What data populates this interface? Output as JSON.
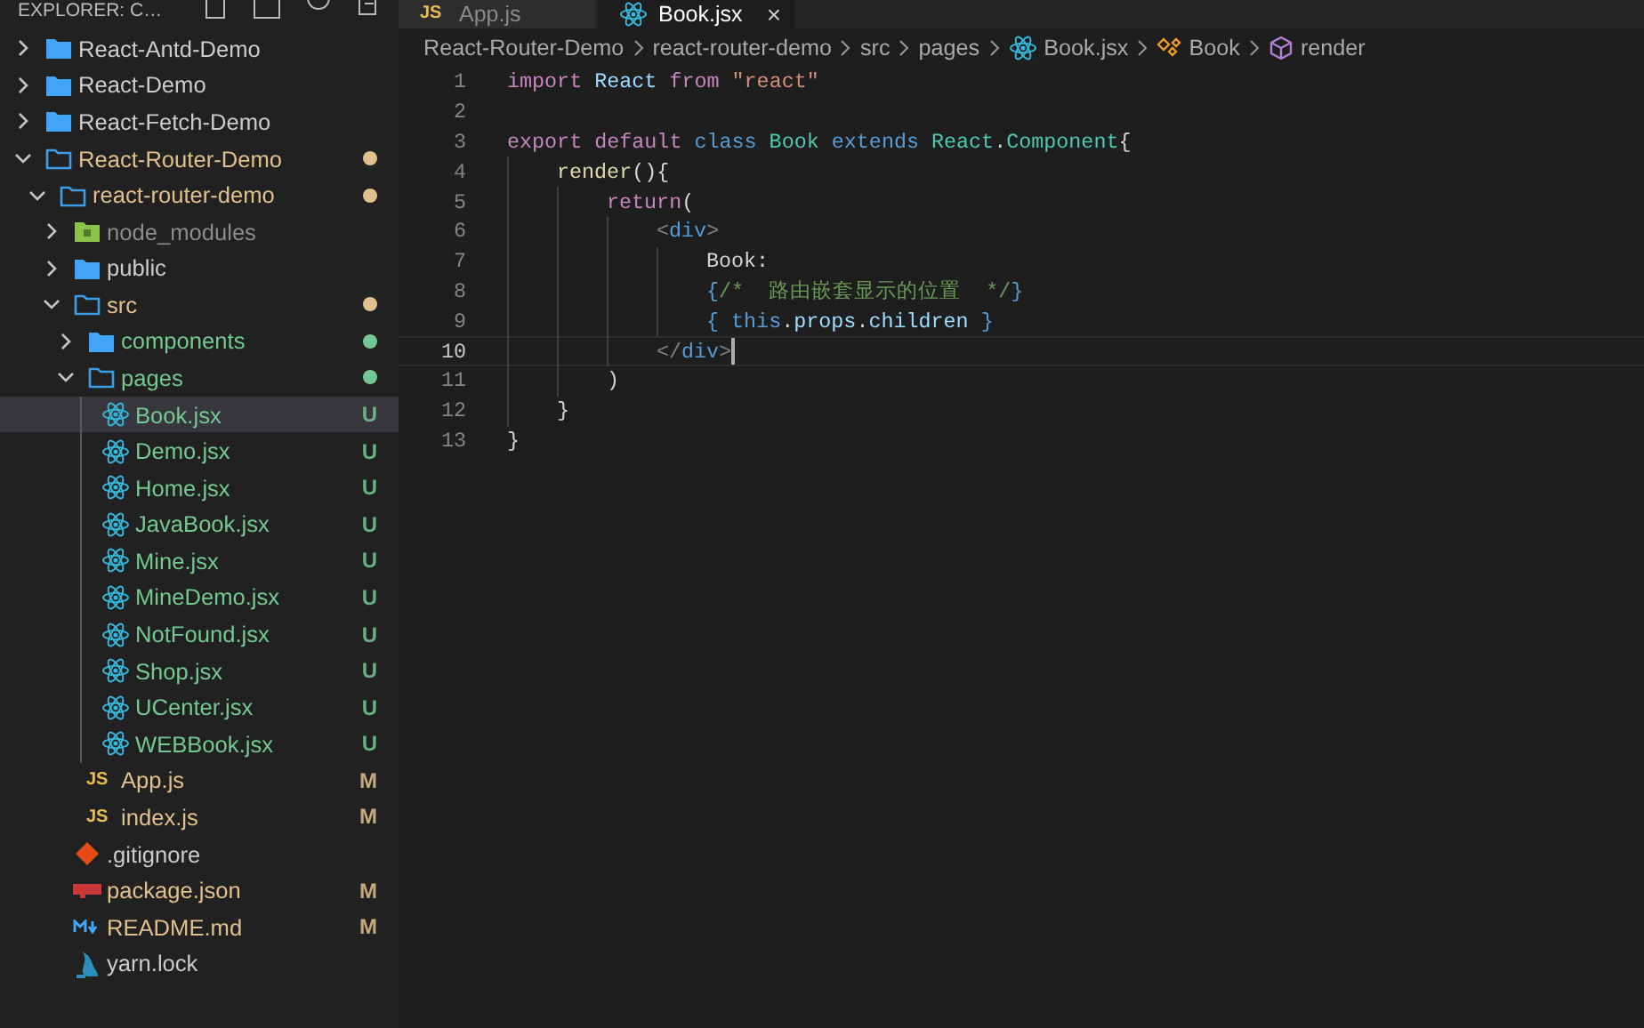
{
  "explorer": {
    "title": "EXPLORER: C…",
    "tree": [
      {
        "label": "React-Antd-Demo",
        "kind": "folder",
        "expanded": false,
        "color": "#cccccc",
        "selected": false
      },
      {
        "label": "React-Demo",
        "kind": "folder",
        "expanded": false,
        "color": "#cccccc",
        "selected": false
      },
      {
        "label": "React-Fetch-Demo",
        "kind": "folder",
        "expanded": false,
        "color": "#cccccc",
        "selected": false
      },
      {
        "label": "React-Router-Demo",
        "kind": "folder",
        "expanded": true,
        "color": "#e2c08d",
        "dot": true,
        "selected": false,
        "children": [
          {
            "label": "react-router-demo",
            "kind": "folder",
            "expanded": true,
            "color": "#e2c08d",
            "dot": true,
            "selected": false,
            "children": [
              {
                "label": "node_modules",
                "kind": "node-folder",
                "expanded": false,
                "color": "#8c8c8c",
                "selected": false
              },
              {
                "label": "public",
                "kind": "folder",
                "expanded": false,
                "color": "#cccccc",
                "selected": false
              },
              {
                "label": "src",
                "kind": "folder",
                "expanded": true,
                "color": "#e2c08d",
                "dot": true,
                "selected": false,
                "children": [
                  {
                    "label": "components",
                    "kind": "folder",
                    "expanded": false,
                    "color": "#73c991",
                    "dot": true,
                    "selected": false
                  },
                  {
                    "label": "pages",
                    "kind": "folder",
                    "expanded": true,
                    "color": "#73c991",
                    "dot": true,
                    "selected": false,
                    "children": [
                      {
                        "label": "Book.jsx",
                        "kind": "react",
                        "color": "#73c991",
                        "badge": "U",
                        "selected": true
                      },
                      {
                        "label": "Demo.jsx",
                        "kind": "react",
                        "color": "#73c991",
                        "badge": "U",
                        "selected": false
                      },
                      {
                        "label": "Home.jsx",
                        "kind": "react",
                        "color": "#73c991",
                        "badge": "U",
                        "selected": false
                      },
                      {
                        "label": "JavaBook.jsx",
                        "kind": "react",
                        "color": "#73c991",
                        "badge": "U",
                        "selected": false
                      },
                      {
                        "label": "Mine.jsx",
                        "kind": "react",
                        "color": "#73c991",
                        "badge": "U",
                        "selected": false
                      },
                      {
                        "label": "MineDemo.jsx",
                        "kind": "react",
                        "color": "#73c991",
                        "badge": "U",
                        "selected": false
                      },
                      {
                        "label": "NotFound.jsx",
                        "kind": "react",
                        "color": "#73c991",
                        "badge": "U",
                        "selected": false
                      },
                      {
                        "label": "Shop.jsx",
                        "kind": "react",
                        "color": "#73c991",
                        "badge": "U",
                        "selected": false
                      },
                      {
                        "label": "UCenter.jsx",
                        "kind": "react",
                        "color": "#73c991",
                        "badge": "U",
                        "selected": false
                      },
                      {
                        "label": "WEBBook.jsx",
                        "kind": "react",
                        "color": "#73c991",
                        "badge": "U",
                        "selected": false
                      }
                    ]
                  },
                  {
                    "label": "App.js",
                    "kind": "js",
                    "icon_text": "JS",
                    "color": "#e2c08d",
                    "badge": "M",
                    "selected": false
                  },
                  {
                    "label": "index.js",
                    "kind": "js",
                    "icon_text": "JS",
                    "color": "#e2c08d",
                    "badge": "M",
                    "selected": false
                  }
                ]
              },
              {
                "label": ".gitignore",
                "kind": "git",
                "color": "#cccccc",
                "selected": false
              },
              {
                "label": "package.json",
                "kind": "npm",
                "color": "#e2c08d",
                "badge": "M",
                "selected": false
              },
              {
                "label": "README.md",
                "kind": "markdown",
                "color": "#e2c08d",
                "badge": "M",
                "selected": false
              },
              {
                "label": "yarn.lock",
                "kind": "yarn",
                "color": "#cccccc",
                "selected": false
              }
            ]
          }
        ]
      }
    ]
  },
  "tabs": [
    {
      "label": "App.js",
      "kind": "js",
      "icon_text": "JS",
      "selected": false
    },
    {
      "label": "Book.jsx",
      "kind": "react",
      "close": "×",
      "selected": true
    }
  ],
  "breadcrumbs": [
    {
      "label": "React-Router-Demo",
      "kind": "folder"
    },
    {
      "label": "react-router-demo",
      "kind": "folder"
    },
    {
      "label": "src",
      "kind": "folder"
    },
    {
      "label": "pages",
      "kind": "folder"
    },
    {
      "label": "Book.jsx",
      "kind": "react"
    },
    {
      "label": "Book",
      "kind": "class"
    },
    {
      "label": "render",
      "kind": "method"
    }
  ],
  "code": [
    {
      "number": "1",
      "current": false,
      "tokens": [
        {
          "text": "import",
          "kind": "keyword"
        },
        {
          "text": "React",
          "kind": "variable",
          "space_before": true
        },
        {
          "text": "from",
          "kind": "keyword",
          "space_before": true
        },
        {
          "text": "\"react\"",
          "kind": "string",
          "space_before": true
        }
      ]
    },
    {
      "number": "2",
      "current": false
    },
    {
      "number": "3",
      "current": false,
      "tokens": [
        {
          "text": "export",
          "kind": "keyword"
        },
        {
          "text": "default",
          "kind": "keyword",
          "space_before": true
        },
        {
          "text": "class",
          "kind": "storage",
          "space_before": true
        },
        {
          "text": "Book",
          "kind": "type",
          "space_before": true
        },
        {
          "text": "extends",
          "kind": "storage",
          "space_before": true
        },
        {
          "text": "React",
          "kind": "type",
          "space_before": true
        },
        {
          "text": ".",
          "kind": "plain"
        },
        {
          "text": "Component",
          "kind": "type"
        },
        {
          "text": "{",
          "kind": "plain"
        }
      ],
      "children": [
        {
          "number": "4",
          "current": false,
          "tokens": [
            {
              "text": "render",
              "kind": "function"
            },
            {
              "text": "(){",
              "kind": "plain"
            }
          ],
          "children": [
            {
              "number": "5",
              "current": false,
              "tokens": [
                {
                  "text": "return",
                  "kind": "keyword"
                },
                {
                  "text": "(",
                  "kind": "plain"
                }
              ],
              "children": [
                {
                  "number": "6",
                  "current": false,
                  "tokens": [
                    {
                      "text": "<",
                      "kind": "tag-punct"
                    },
                    {
                      "text": "div",
                      "kind": "storage"
                    },
                    {
                      "text": ">",
                      "kind": "tag-punct"
                    }
                  ],
                  "children": [
                    {
                      "number": "7",
                      "current": false,
                      "tokens": [
                        {
                          "text": "Book:",
                          "kind": "plain"
                        }
                      ]
                    },
                    {
                      "number": "8",
                      "current": false,
                      "tokens": [
                        {
                          "text": "{",
                          "kind": "storage"
                        },
                        {
                          "text": "/*  路由嵌套显示的位置  */",
                          "kind": "comment"
                        },
                        {
                          "text": "}",
                          "kind": "storage"
                        }
                      ]
                    },
                    {
                      "number": "9",
                      "current": false,
                      "tokens": [
                        {
                          "text": "{",
                          "kind": "storage"
                        },
                        {
                          "text": "this",
                          "kind": "storage",
                          "space_before": true
                        },
                        {
                          "text": ".",
                          "kind": "plain"
                        },
                        {
                          "text": "props",
                          "kind": "variable"
                        },
                        {
                          "text": ".",
                          "kind": "plain"
                        },
                        {
                          "text": "children",
                          "kind": "variable"
                        },
                        {
                          "text": "}",
                          "kind": "storage",
                          "space_before": true
                        }
                      ]
                    }
                  ]
                },
                {
                  "number": "10",
                  "current": true,
                  "tokens": [
                    {
                      "text": "</",
                      "kind": "tag-punct"
                    },
                    {
                      "text": "div",
                      "kind": "storage"
                    },
                    {
                      "text": ">",
                      "kind": "tag-punct"
                    }
                  ]
                }
              ]
            },
            {
              "number": "11",
              "current": false,
              "tokens": [
                {
                  "text": ")",
                  "kind": "plain"
                }
              ]
            }
          ]
        },
        {
          "number": "12",
          "current": false,
          "tokens": [
            {
              "text": "}",
              "kind": "plain"
            }
          ]
        }
      ]
    },
    {
      "number": "13",
      "current": false,
      "tokens": [
        {
          "text": "}",
          "kind": "plain"
        }
      ]
    }
  ]
}
